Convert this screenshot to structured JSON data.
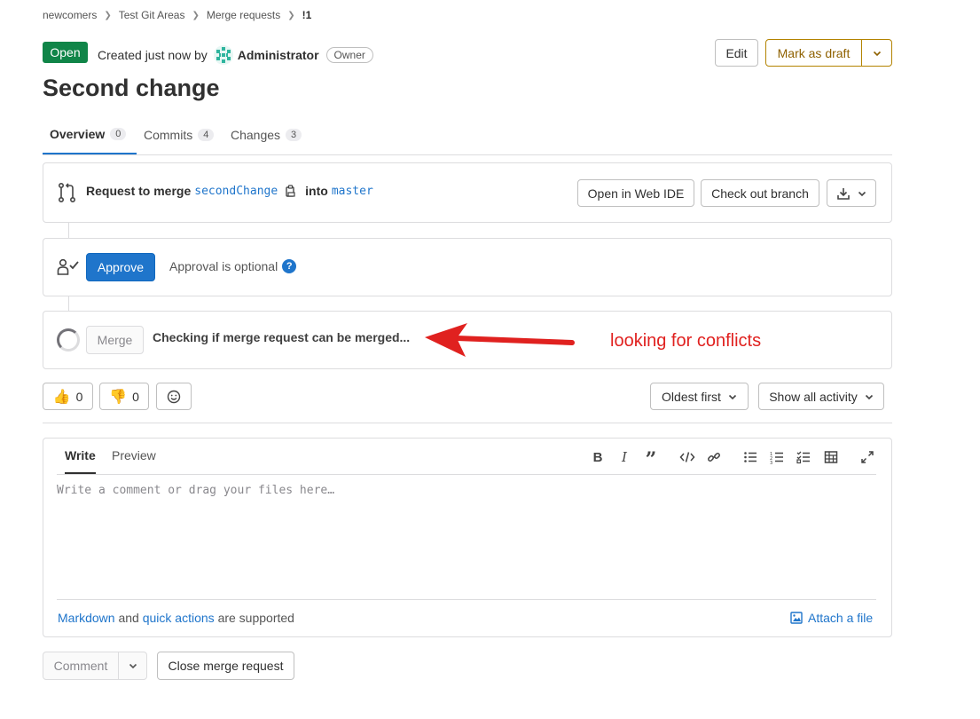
{
  "breadcrumb": [
    "newcomers",
    "Test Git Areas",
    "Merge requests",
    "!1"
  ],
  "header": {
    "status": "Open",
    "created_prefix": "Created just now by",
    "author": "Administrator",
    "role": "Owner",
    "edit_label": "Edit",
    "draft_label": "Mark as draft"
  },
  "title": "Second change",
  "tabs": [
    {
      "label": "Overview",
      "count": "0"
    },
    {
      "label": "Commits",
      "count": "4"
    },
    {
      "label": "Changes",
      "count": "3"
    }
  ],
  "merge_request": {
    "request_label": "Request to merge",
    "source_branch": "secondChange",
    "into_label": "into",
    "target_branch": "master",
    "web_ide_label": "Open in Web IDE",
    "checkout_label": "Check out branch"
  },
  "approval": {
    "approve_label": "Approve",
    "status_text": "Approval is optional"
  },
  "merge": {
    "merge_label": "Merge",
    "status_text": "Checking if merge request can be merged..."
  },
  "annotation": "looking for conflicts",
  "annotation_color": "#e0211f",
  "reactions": {
    "thumbs_up": "0",
    "thumbs_down": "0"
  },
  "sort": {
    "order_label": "Oldest first",
    "activity_label": "Show all activity"
  },
  "editor": {
    "write_tab": "Write",
    "preview_tab": "Preview",
    "placeholder": "Write a comment or drag your files here…",
    "markdown_link": "Markdown",
    "and_text": "and",
    "quick_actions_link": "quick actions",
    "supported_text": "are supported",
    "attach_label": "Attach a file"
  },
  "footer": {
    "comment_label": "Comment",
    "close_label": "Close merge request"
  },
  "colors": {
    "accent": "#1f75cb",
    "open_badge": "#108548",
    "draft": "#8f6100"
  }
}
